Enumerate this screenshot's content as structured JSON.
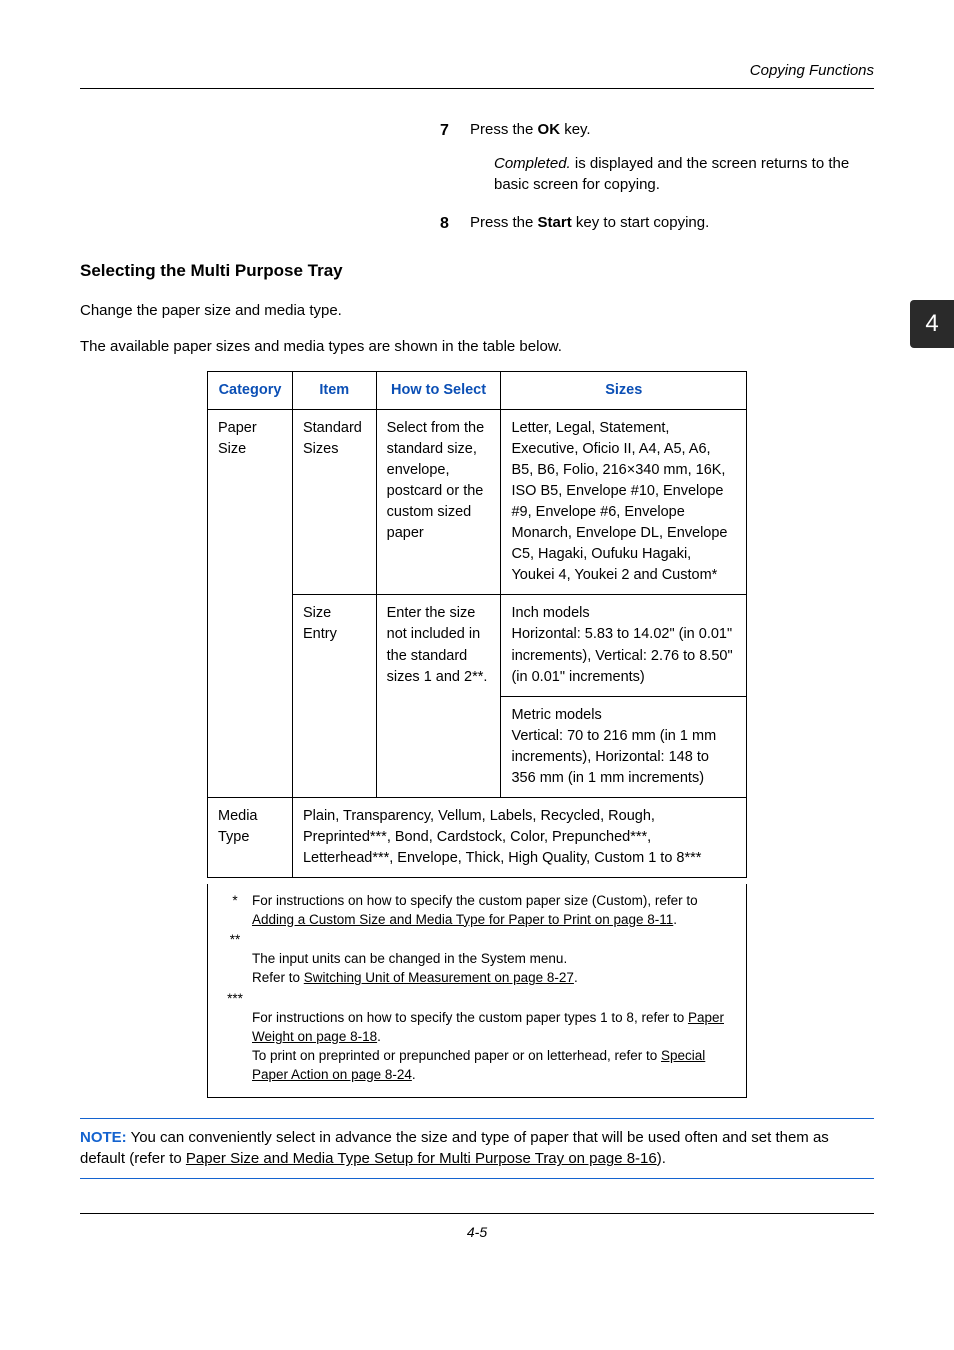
{
  "header": {
    "section_title": "Copying Functions"
  },
  "tab": {
    "number": "4"
  },
  "steps": [
    {
      "num": "7",
      "line1": "Press the ",
      "bold1": "OK",
      "line1_after": " key.",
      "indent_italic": "Completed.",
      "indent_rest": " is displayed and the screen returns to the basic screen for copying."
    },
    {
      "num": "8",
      "line1": "Press the ",
      "bold1": "Start",
      "line1_after": " key to start copying."
    }
  ],
  "h2": "Selecting the Multi Purpose Tray",
  "paras": {
    "p1": "Change the paper size and media type.",
    "p2": "The available paper sizes and media types are shown in the table below."
  },
  "table": {
    "headers": {
      "c1": "Category",
      "c2": "Item",
      "c3": "How to Select",
      "c4": "Sizes"
    },
    "rows": {
      "paper_size_label": "Paper Size",
      "std_sizes_label": "Standard Sizes",
      "std_sizes_howto": "Select from the standard size, envelope, postcard or the custom sized paper",
      "std_sizes_sizes": "Letter, Legal, Statement, Executive, Oficio II, A4, A5, A6, B5, B6, Folio, 216×340 mm, 16K, ISO B5, Envelope #10, Envelope #9, Envelope #6, Envelope Monarch, Envelope DL, Envelope C5, Hagaki, Oufuku Hagaki, Youkei 4, Youkei 2 and Custom*",
      "size_entry_label": "Size Entry",
      "size_entry_howto": "Enter the size not included in the standard sizes 1 and 2**.",
      "size_entry_inch": "Inch models\nHorizontal: 5.83 to 14.02\" (in 0.01\" increments), Vertical: 2.76 to 8.50\" (in 0.01\" increments)",
      "size_entry_metric": "Metric models\nVertical: 70 to 216 mm (in 1 mm increments), Horizontal: 148 to 356 mm (in 1 mm increments)",
      "media_type_label": "Media Type",
      "media_type_body": "Plain, Transparency, Vellum, Labels, Recycled, Rough, Preprinted***, Bond, Cardstock, Color, Prepunched***, Letterhead***, Envelope, Thick, High Quality, Custom 1 to 8***"
    }
  },
  "footnotes": {
    "fn1_pre": "For instructions on how to specify the custom paper size (Custom), refer to ",
    "fn1_link": "Adding a Custom Size and Media Type for Paper to Print on page 8-11",
    "fn1_post": ".",
    "fn2_pre": "The input units can be changed in the System menu.\nRefer to ",
    "fn2_link": "Switching Unit of Measurement on page 8-27",
    "fn2_post": ".",
    "fn3_pre": "For instructions on how to specify the custom paper types 1 to 8, refer to ",
    "fn3_link": "Paper Weight on page 8-18",
    "fn3_mid": ".\nTo print on preprinted or prepunched paper or on letterhead, refer to ",
    "fn3_link2": "Special Paper Action on page 8-24",
    "fn3_post": "."
  },
  "note": {
    "label": "NOTE:",
    "text_pre": " You can conveniently select in advance the size and type of paper that will be used often and set them as default (refer to ",
    "link": "Paper Size and Media Type Setup for Multi Purpose Tray on page 8-16",
    "text_post": ")."
  },
  "footer": {
    "page": "4-5"
  }
}
